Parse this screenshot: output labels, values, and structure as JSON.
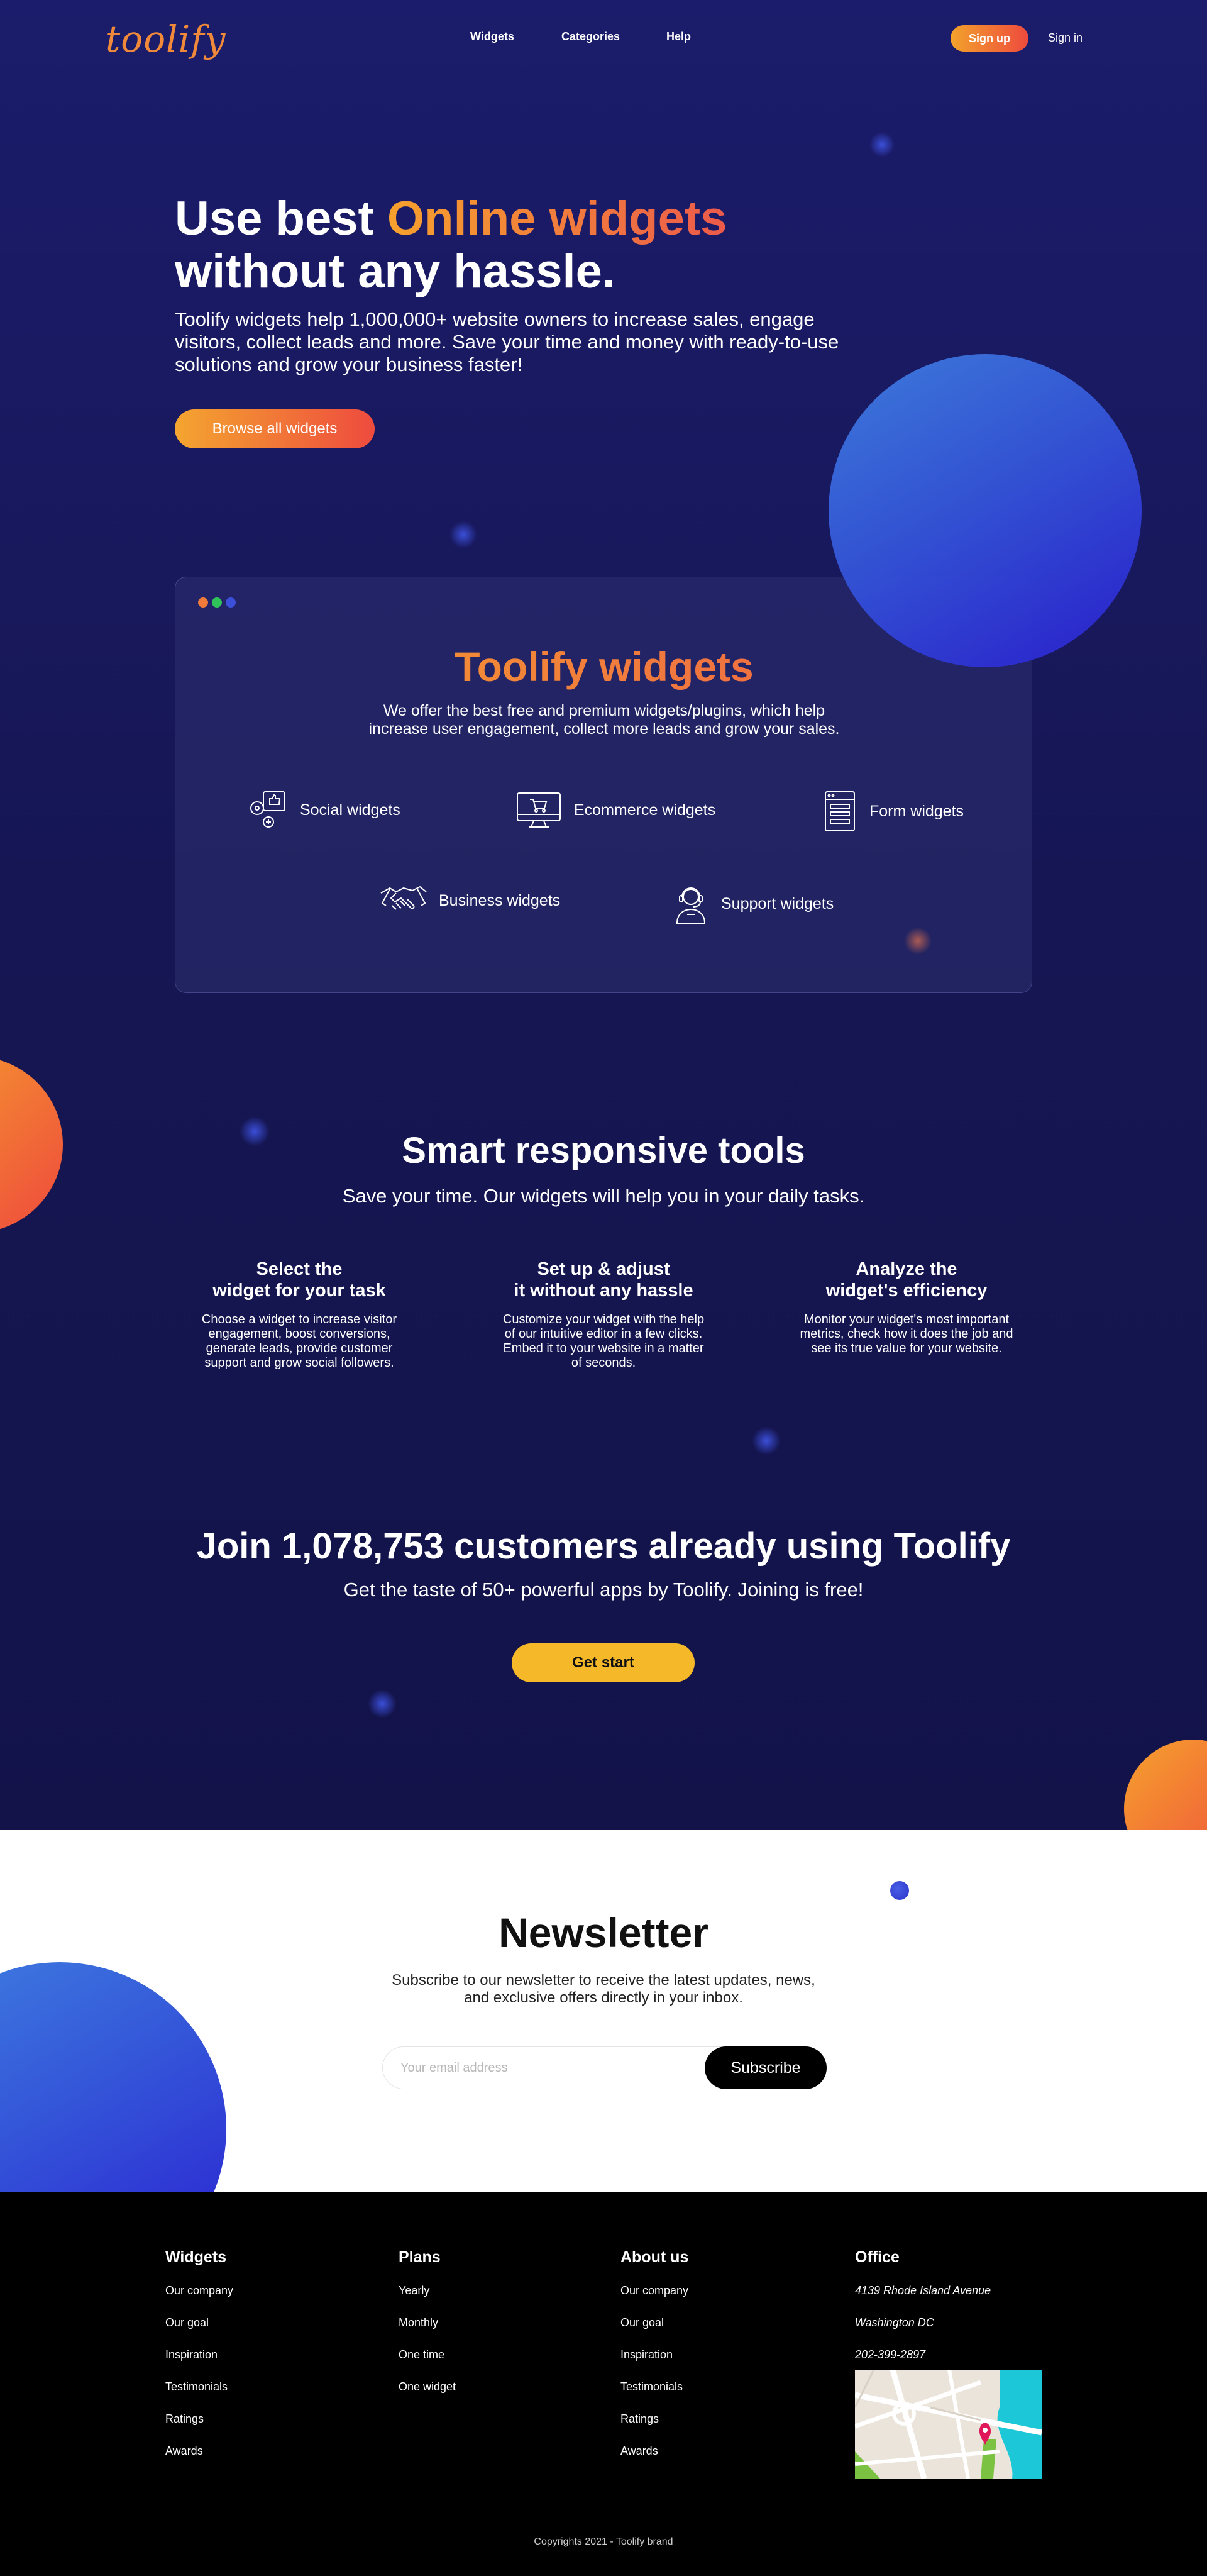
{
  "brand": {
    "logo": "toolify"
  },
  "nav": {
    "items": [
      "Widgets",
      "Categories",
      "Help"
    ],
    "signup": "Sign up",
    "signin": "Sign in"
  },
  "hero": {
    "title_part1": "Use best ",
    "title_accent": "Online widgets",
    "title_part2": "without any hassle.",
    "subtitle": "Toolify widgets help 1,000,000+ website owners to increase sales, engage visitors, collect leads and more. Save your time and money with ready-to-use solutions and grow your business faster!",
    "cta": "Browse all widgets"
  },
  "widgets_card": {
    "title": "Toolify widgets",
    "subtitle": "We offer the best free and premium widgets/plugins, which help increase user engagement, collect more leads and grow your sales.",
    "categories": [
      {
        "label": "Social widgets",
        "icon": "social-icon"
      },
      {
        "label": "Ecommerce widgets",
        "icon": "ecommerce-icon"
      },
      {
        "label": "Form widgets",
        "icon": "form-icon"
      },
      {
        "label": "Business widgets",
        "icon": "handshake-icon"
      },
      {
        "label": "Support widgets",
        "icon": "support-agent-icon"
      }
    ]
  },
  "smart": {
    "title": "Smart responsive tools",
    "subtitle": "Save your time. Our widgets will help you in your daily tasks.",
    "features": [
      {
        "title_line1": "Select the",
        "title_line2": "widget for your task",
        "text": "Choose a widget to increase visitor engagement, boost conversions, generate leads, provide customer support and grow social followers."
      },
      {
        "title_line1": "Set up & adjust",
        "title_line2": "it without any hassle",
        "text": "Customize your widget with the help of our intuitive editor in a few clicks. Embed it to your website in a matter of seconds."
      },
      {
        "title_line1": "Analyze the",
        "title_line2": "widget's efficiency",
        "text": "Monitor your widget's most important metrics, check how it does the job and see its true value for your website."
      }
    ]
  },
  "join": {
    "title": "Join 1,078,753 customers already using Toolify",
    "subtitle": "Get the taste of 50+ powerful apps by Toolify. Joining is free!",
    "cta": "Get start"
  },
  "newsletter": {
    "title": "Newsletter",
    "subtitle": "Subscribe to our newsletter to receive the latest updates, news, and exclusive offers directly in your inbox.",
    "placeholder": "Your email address",
    "button": "Subscribe"
  },
  "footer": {
    "columns": [
      {
        "title": "Widgets",
        "links": [
          "Our company",
          "Our goal",
          "Inspiration",
          "Testimonials",
          "Ratings",
          "Awards"
        ]
      },
      {
        "title": "Plans",
        "links": [
          "Yearly",
          "Monthly",
          "One time",
          "One widget"
        ]
      },
      {
        "title": "About us",
        "links": [
          "Our company",
          "Our goal",
          "Inspiration",
          "Testimonials",
          "Ratings",
          "Awards"
        ]
      }
    ],
    "office": {
      "title": "Office",
      "address1": "4139 Rhode Island Avenue",
      "address2": "Washington DC",
      "phone": "202-399-2897"
    },
    "copyright": "Copyrights 2021 - Toolify brand"
  },
  "colors": {
    "accent_orange": "#f6a12d",
    "accent_red": "#ec5a4b",
    "dark_bg": "#161654",
    "yellow": "#f5b829",
    "blue": "#3a44d8"
  }
}
